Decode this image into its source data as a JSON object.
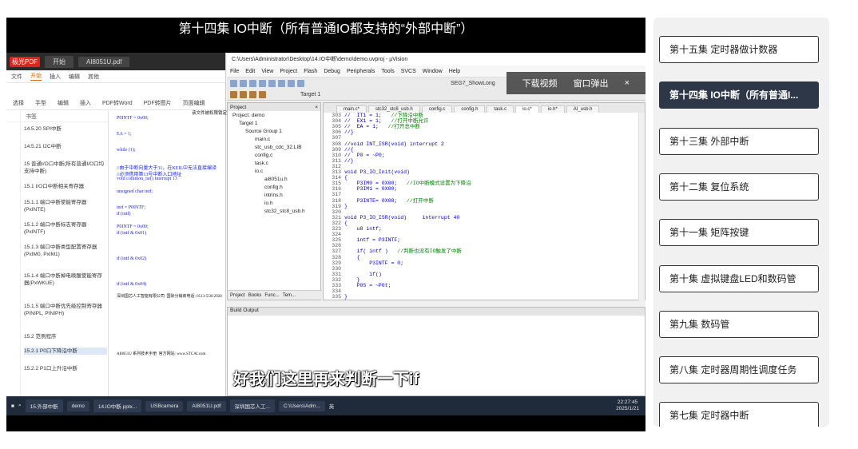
{
  "video": {
    "title": "第十四集 IO中断（所有普通IO都支持的“外部中断”）",
    "subtitle": "好我们这里再来判断一下if",
    "overlay_download": "下载视频",
    "overlay_popout": "窗口弹出",
    "overlay_close": "×"
  },
  "pdf": {
    "app": "极光PDF",
    "tab1": "开始",
    "tab2": "AI8051U.pdf",
    "menu": [
      "文件",
      "开始",
      "插入",
      "编辑",
      "其他"
    ],
    "tools": [
      "选择",
      "手型",
      "编辑",
      "插入",
      "PDF转Word",
      "PDF转图片",
      "页面编辑"
    ],
    "outline_head": "书签",
    "outline": [
      "14.5.20 SPI中断",
      "14.5.21 I2C中断",
      "15 普通I/O口中断(所有普通I/O口均支持中断)",
      "15.1 I/O口中断相关寄存器",
      "15.1.1 端口中断使能寄存器(PxINTE)",
      "15.1.2 端口中断标志寄存器(PxINTF)",
      "15.1.3 端口中断类型配置寄存器(PxIM0, PxIM1)",
      "15.1.4 端口中断掉电唤醒使能寄存器(PxWKUE)",
      "15.1.5 端口中断优先级控制寄存器(PINIPL, PINIPH)",
      "15.2 范例程序",
      "15.2.1 P0口下降沿中断",
      "15.2.2 P1口上升沿中断"
    ],
    "page_lines": [
      "P0INTF = 0x00;",
      "EA = 1;",
      "while (1);",
      "//由于中断向量大于31，在KEIL中无法直接编译",
      "//必须借用第13号中断入口地址",
      "void common_isr() interrupt 13",
      "unsigned char intf;",
      "intf = P0INTF;",
      "if (intf)",
      "P0INTF = 0x00;",
      "if (intf & 0x01)",
      "if (intf & 0x02)",
      "if (intf & 0x04)",
      "深圳国芯人工智能有限公司  国际分销商电话: 0513-55012928",
      "AI8051U 系列技术手册  官方网站: www.STCAI.com",
      "该文件被权限锁定"
    ]
  },
  "uv": {
    "title": "C:\\Users\\Administrator\\Desktop\\14.IO中断\\demo\\demo.uvproj - µVision",
    "menu": [
      "File",
      "Edit",
      "View",
      "Project",
      "Flash",
      "Debug",
      "Peripherals",
      "Tools",
      "SVCS",
      "Window",
      "Help"
    ],
    "target": "Target 1",
    "target_tb": "SEG7_ShowLong",
    "project_head": "Project",
    "tree": [
      "Project: demo",
      "Target 1",
      "Source Group 1",
      "main.c",
      "stc_usb_cdc_32.LIB",
      "config.c",
      "task.c",
      "io.c",
      "ai8051u.h",
      "config.h",
      "intrins.h",
      "io.h",
      "stc32_stc8_usb.h"
    ],
    "proj_tabs": [
      "Project",
      "Books",
      "Func...",
      "Tem..."
    ],
    "editor_tabs": [
      "main.c*",
      "stc32_stc8_usb.h",
      "config.c",
      "config.h",
      "task.c",
      "io.c*",
      "io.h*",
      "AI_usb.h"
    ],
    "code": [
      [
        "303",
        "//  IT1 = 1;",
        "//下降沿中断"
      ],
      [
        "304",
        "//  EX1 = 1;",
        "//打开中断允许"
      ],
      [
        "305",
        "//  EA = 1;",
        "//打开总中断"
      ],
      [
        "306",
        "//}",
        ""
      ],
      [
        "307",
        "",
        ""
      ],
      [
        "308",
        "//void INT_ISR(void) interrupt 2",
        ""
      ],
      [
        "309",
        "//{",
        ""
      ],
      [
        "310",
        "//  P0 = ~P0;",
        ""
      ],
      [
        "311",
        "//}",
        ""
      ],
      [
        "312",
        "",
        ""
      ],
      [
        "313",
        "void P3_IO_Init(void)",
        ""
      ],
      [
        "314",
        "{",
        ""
      ],
      [
        "315",
        "    P3IM0 = 0X00;",
        "//IO中断模式设置为下降沿"
      ],
      [
        "316",
        "    P3IM1 = 0X00;",
        ""
      ],
      [
        "317",
        "",
        ""
      ],
      [
        "318",
        "    P3INTE= 0X08;",
        "//打开中断"
      ],
      [
        "319",
        "}",
        ""
      ],
      [
        "320",
        "",
        ""
      ],
      [
        "321",
        "void P3_IO_ISR(void)     interrupt 40",
        ""
      ],
      [
        "322",
        "{",
        ""
      ],
      [
        "323",
        "    u8 intf;",
        ""
      ],
      [
        "324",
        "",
        ""
      ],
      [
        "325",
        "    intf = P3INTF;",
        ""
      ],
      [
        "326",
        "",
        ""
      ],
      [
        "327",
        "    if( intf )",
        "//判断也没有IO触发了中断"
      ],
      [
        "328",
        "    {",
        ""
      ],
      [
        "329",
        "        P3INTF = 0;",
        ""
      ],
      [
        "330",
        "",
        ""
      ],
      [
        "331",
        "        if()",
        ""
      ],
      [
        "332",
        "    }",
        ""
      ],
      [
        "333",
        "    P0S = ~P0t;",
        ""
      ],
      [
        "334",
        "",
        ""
      ],
      [
        "335",
        "}",
        ""
      ]
    ],
    "build_head": "Build Output"
  },
  "taskbar": {
    "items": [
      "15.外部中断",
      "demo",
      "14.IO中断.pptx...",
      "USBcamera",
      "AI8051U.pdf",
      "深圳国芯人工...",
      "C:\\Users\\Adm..."
    ],
    "ime": "英",
    "time": "22:27:45",
    "date": "2025/1/21"
  },
  "playlist": {
    "items": [
      {
        "label": "第十五集 定时器做计数器",
        "active": false
      },
      {
        "label": "第十四集 IO中断（所有普通IO都支持的“外部中断”）",
        "active": true
      },
      {
        "label": "第十三集 外部中断",
        "active": false
      },
      {
        "label": "第十二集 复位系统",
        "active": false
      },
      {
        "label": "第十一集 矩阵按键",
        "active": false
      },
      {
        "label": "第十集 虚拟键盘LED和数码管",
        "active": false
      },
      {
        "label": "第九集 数码管",
        "active": false
      },
      {
        "label": "第八集 定时器周期性调度任务",
        "active": false
      },
      {
        "label": "第七集 定时器中断",
        "active": false
      }
    ]
  }
}
